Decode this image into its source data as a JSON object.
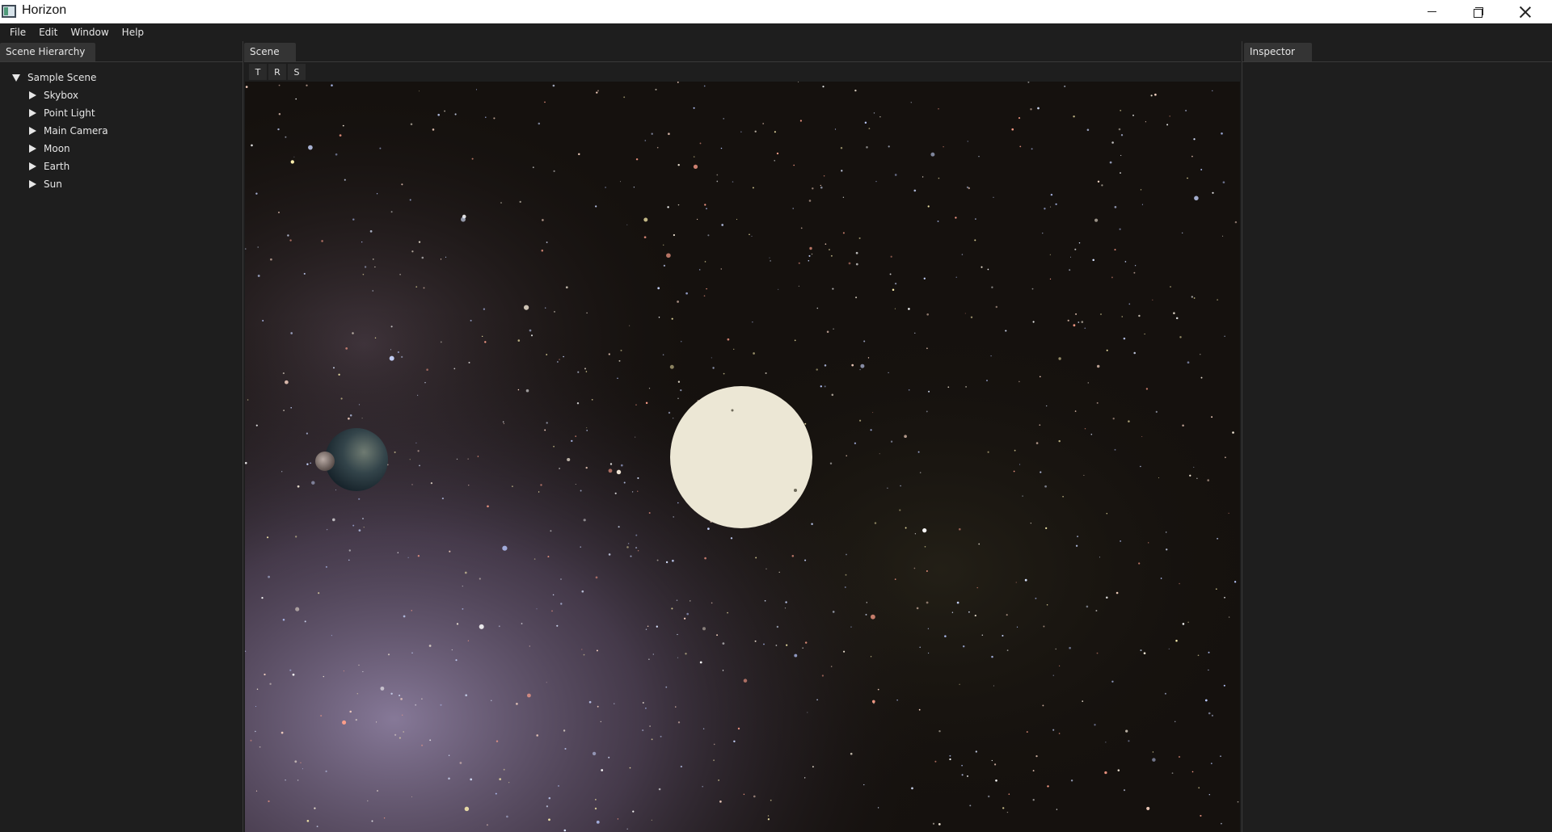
{
  "window": {
    "title": "Horizon"
  },
  "menu": [
    {
      "label": "File"
    },
    {
      "label": "Edit"
    },
    {
      "label": "Window"
    },
    {
      "label": "Help"
    }
  ],
  "hierarchy": {
    "tab_label": "Scene Hierarchy",
    "root": {
      "label": "Sample Scene",
      "expanded": true
    },
    "items": [
      {
        "label": "Skybox"
      },
      {
        "label": "Point Light"
      },
      {
        "label": "Main Camera"
      },
      {
        "label": "Moon"
      },
      {
        "label": "Earth"
      },
      {
        "label": "Sun"
      }
    ]
  },
  "scene": {
    "tab_label": "Scene",
    "tools": [
      {
        "label": "T"
      },
      {
        "label": "R"
      },
      {
        "label": "S"
      }
    ]
  },
  "inspector": {
    "tab_label": "Inspector"
  },
  "colors": {
    "background": "#1e1e1e",
    "tab": "#343434",
    "text": "#e6e6e6",
    "sun": "#ece7d5",
    "space": "#14100d",
    "nebula": "#8a7a9e"
  },
  "icons": {
    "app": "app-icon",
    "minimize": "minimize-icon",
    "restore": "restore-icon",
    "close": "close-icon",
    "expanded": "triangle-down-icon",
    "collapsed": "triangle-right-icon"
  }
}
